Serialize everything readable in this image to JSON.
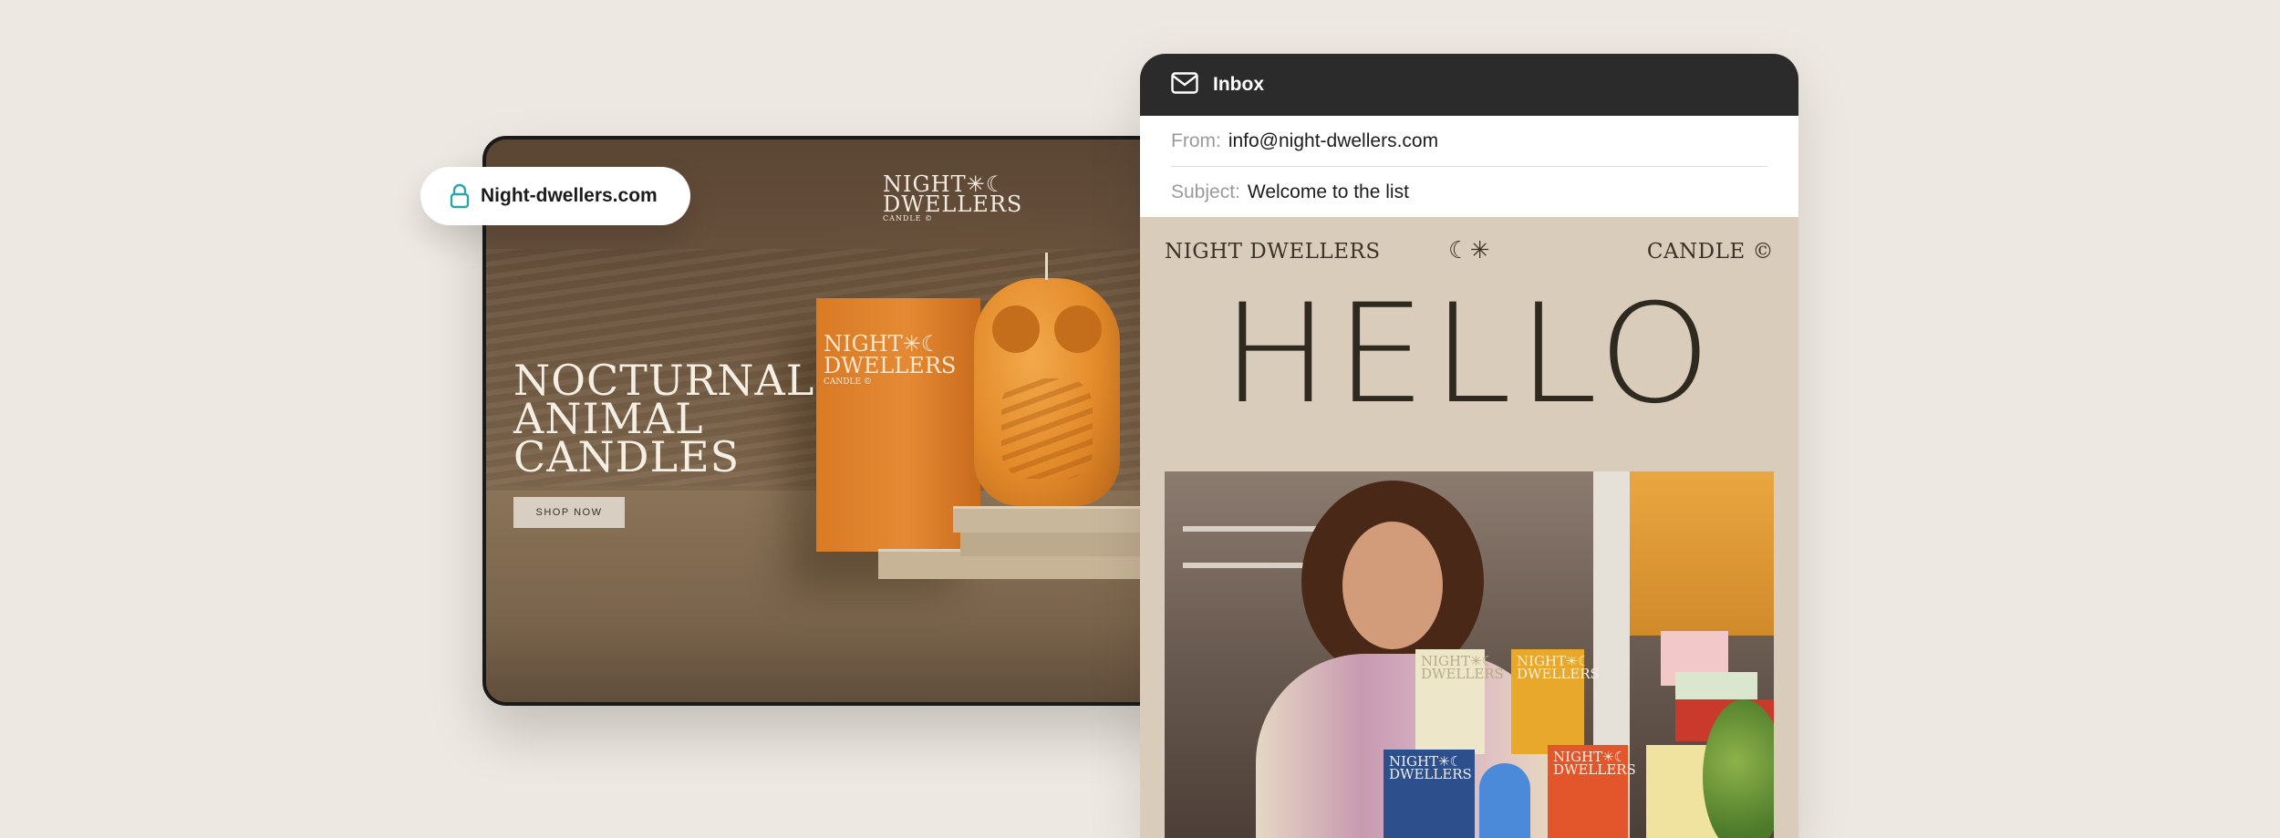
{
  "website": {
    "url": "Night-dwellers.com",
    "logo_line1": "NIGHT✳☾",
    "logo_line2": "DWELLERS",
    "logo_sub": "CANDLE ©",
    "hero_title": "NOCTURNAL ANIMAL CANDLES",
    "cta": "SHOP NOW",
    "product_box_logo_line1": "NIGHT✳☾",
    "product_box_logo_line2": "DWELLERS",
    "product_box_sub": "CANDLE ©"
  },
  "email": {
    "header_title": "Inbox",
    "from_label": "From:",
    "from_value": "info@night-dwellers.com",
    "subject_label": "Subject:",
    "subject_value": "Welcome to the list",
    "brand_left": "NIGHT DWELLERS",
    "brand_center": "☾✳",
    "brand_right": "CANDLE ©",
    "headline": "HELLO",
    "photo_box_labels": [
      "NIGHT✳☾ DWELLERS",
      "NIGHT✳☾ DWELLERS",
      "NIGHT✳☾ DWELLERS",
      "NIGHT✳☾ DWELLERS"
    ]
  },
  "icons": {
    "lock": "lock-icon",
    "mail": "mail-icon"
  },
  "colors": {
    "background": "#ede8e1",
    "email_header": "#2b2b2b",
    "email_body": "#d9ccbb",
    "lock_accent": "#2aa6a6"
  }
}
